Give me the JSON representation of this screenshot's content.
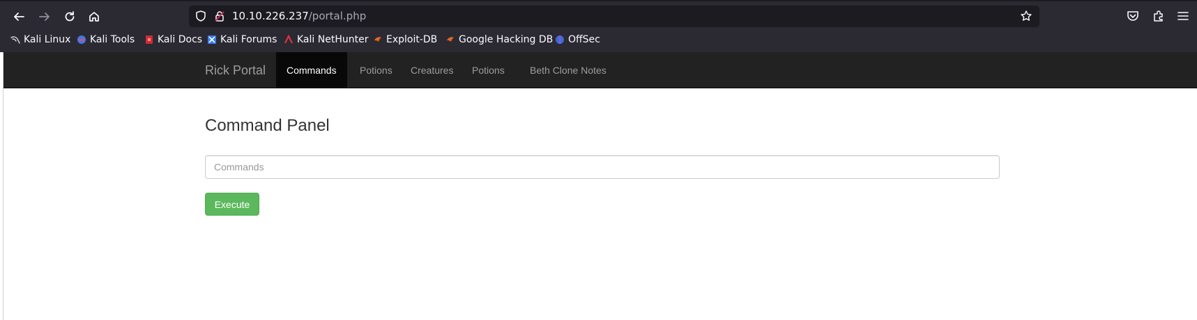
{
  "browser": {
    "url_host": "10.10.226.237",
    "url_path": "/portal.php",
    "bookmarks": [
      {
        "label": "Kali Linux",
        "icon": "kali-dragon-icon"
      },
      {
        "label": "Kali Tools",
        "icon": "kali-tools-icon"
      },
      {
        "label": "Kali Docs",
        "icon": "kali-docs-icon"
      },
      {
        "label": "Kali Forums",
        "icon": "kali-forums-icon"
      },
      {
        "label": "Kali NetHunter",
        "icon": "nethunter-icon"
      },
      {
        "label": "Exploit-DB",
        "icon": "exploit-db-icon"
      },
      {
        "label": "Google Hacking DB",
        "icon": "ghdb-icon"
      },
      {
        "label": "OffSec",
        "icon": "offsec-icon"
      }
    ]
  },
  "navbar": {
    "brand": "Rick Portal",
    "items": [
      {
        "label": "Commands",
        "active": true
      },
      {
        "label": "Potions",
        "active": false
      },
      {
        "label": "Creatures",
        "active": false
      },
      {
        "label": "Potions",
        "active": false
      },
      {
        "label": "Beth Clone Notes",
        "active": false
      }
    ]
  },
  "main": {
    "title": "Command Panel",
    "input_placeholder": "Commands",
    "input_value": "",
    "execute_label": "Execute"
  },
  "colors": {
    "navbar_bg": "#222222",
    "active_tab_bg": "#080808",
    "button_green": "#5cb85c",
    "chrome_bg": "#2b2a33"
  }
}
